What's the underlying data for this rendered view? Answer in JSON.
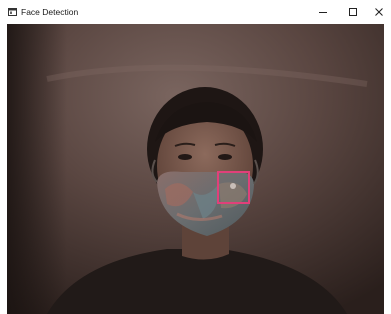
{
  "window": {
    "title": "Face Detection",
    "icon": "app-window-icon",
    "controls": {
      "minimize": "minimize-icon",
      "maximize": "maximize-icon",
      "close": "close-icon"
    }
  },
  "camera_feed": {
    "content": "webcam-frame",
    "detection_box_color": "#e0407a"
  },
  "colors": {
    "titlebar": "#ffffff",
    "wall_dark": "#2b201d",
    "wall_light": "#6b5650",
    "skin": "#7a5a4e",
    "hair": "#1e1614",
    "shirt": "#221b19",
    "mask_base": "#6e6a66",
    "detection_box": "#e0407a"
  }
}
